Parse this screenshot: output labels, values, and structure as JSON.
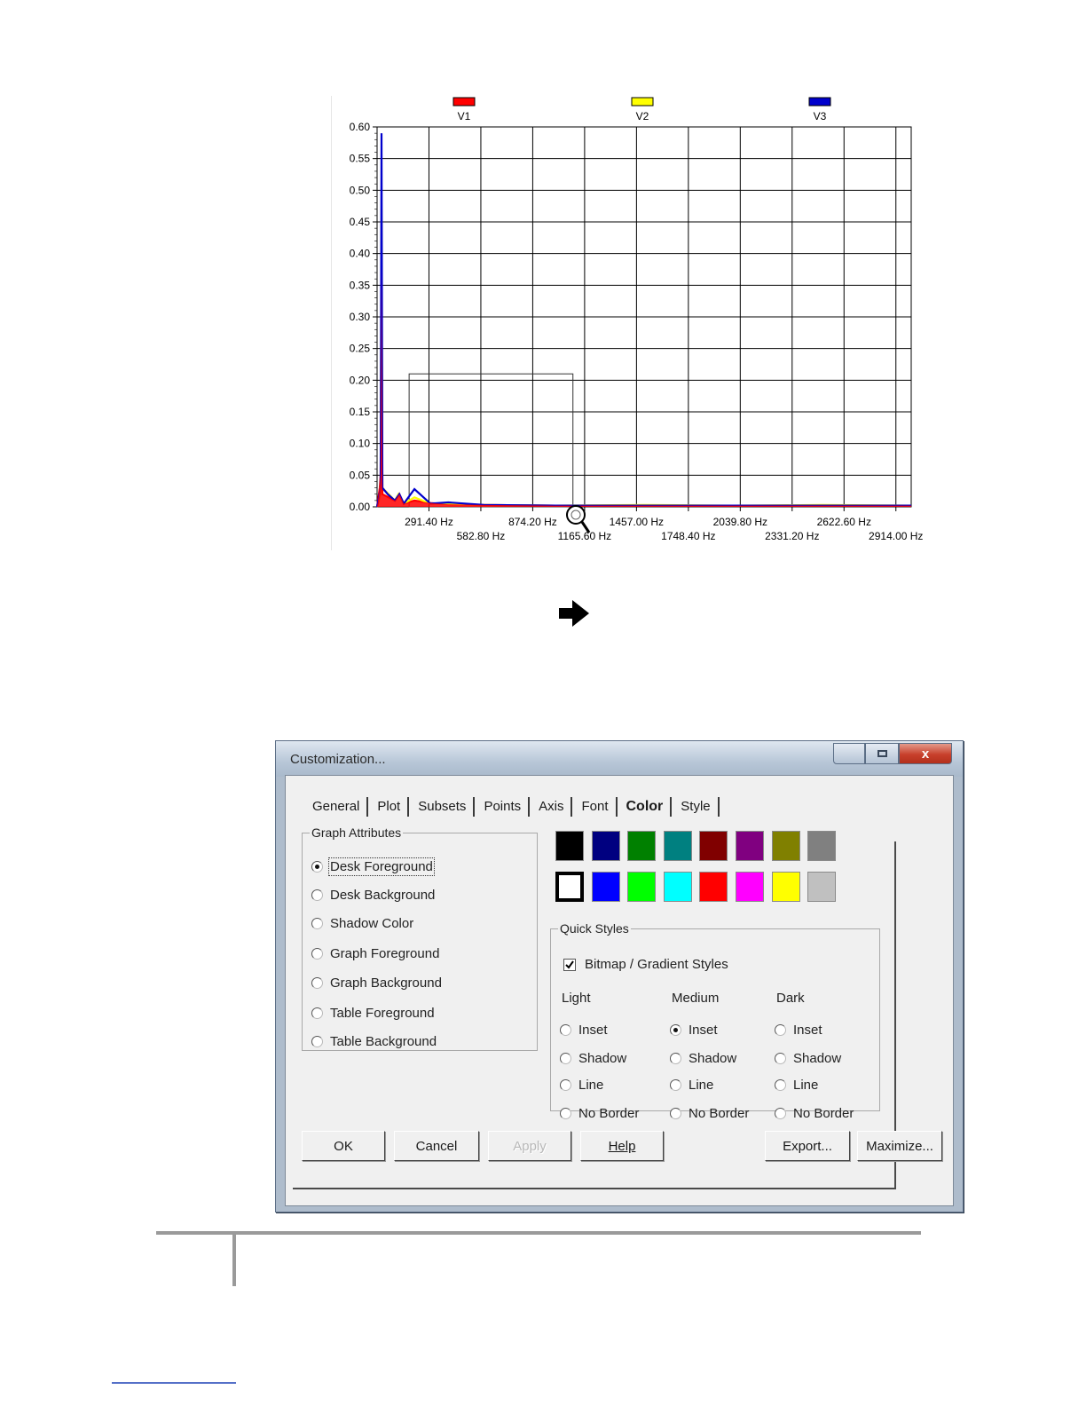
{
  "chart_data": {
    "type": "line",
    "title": "",
    "xlabel": "",
    "ylabel": "",
    "xlim": [
      0,
      3000
    ],
    "ylim": [
      0,
      0.6
    ],
    "x_unit": "Hz",
    "legend_position": "top",
    "grid": true,
    "y_ticks": [
      "0.00",
      "0.05",
      "0.10",
      "0.15",
      "0.20",
      "0.25",
      "0.30",
      "0.35",
      "0.40",
      "0.45",
      "0.50",
      "0.55",
      "0.60"
    ],
    "x_tick_values": [
      291.4,
      582.8,
      874.2,
      1165.6,
      1457.0,
      1748.4,
      2039.8,
      2331.2,
      2622.6,
      2914.0
    ],
    "x_ticks": [
      "291.40 Hz",
      "582.80 Hz",
      "874.20 Hz",
      "1165.60 Hz",
      "1457.00 Hz",
      "1748.40 Hz",
      "2039.80 Hz",
      "2331.20 Hz",
      "2622.60 Hz",
      "2914.00 Hz"
    ],
    "zoom_box": {
      "x": [
        180,
        1100
      ],
      "y": [
        0,
        0.21
      ]
    },
    "series": [
      {
        "name": "V1",
        "color": "#ff0000",
        "points": [
          [
            0,
            0
          ],
          [
            15,
            0.03
          ],
          [
            20,
            0.05
          ],
          [
            25,
            0.38
          ],
          [
            30,
            0.02
          ],
          [
            100,
            0.01
          ],
          [
            125,
            0.02
          ],
          [
            150,
            0.005
          ],
          [
            210,
            0.01
          ],
          [
            300,
            0.006
          ],
          [
            400,
            0.004
          ],
          [
            600,
            0.003
          ],
          [
            1000,
            0.002
          ],
          [
            1500,
            0.002
          ],
          [
            2000,
            0.002
          ],
          [
            2500,
            0.002
          ],
          [
            3000,
            0.002
          ]
        ]
      },
      {
        "name": "V2",
        "color": "#ffff00",
        "points": [
          [
            0,
            0
          ],
          [
            20,
            0.02
          ],
          [
            25,
            0.47
          ],
          [
            30,
            0.03
          ],
          [
            100,
            0.01
          ],
          [
            120,
            0.02
          ],
          [
            150,
            0.005
          ],
          [
            210,
            0.015
          ],
          [
            300,
            0.005
          ],
          [
            600,
            0.003
          ],
          [
            1000,
            0.002
          ],
          [
            1500,
            0.003
          ],
          [
            2000,
            0.002
          ],
          [
            2500,
            0.003
          ],
          [
            3000,
            0.002
          ]
        ]
      },
      {
        "name": "V3",
        "color": "#0000cc",
        "points": [
          [
            0,
            0
          ],
          [
            20,
            0.03
          ],
          [
            25,
            0.59
          ],
          [
            30,
            0.03
          ],
          [
            60,
            0.02
          ],
          [
            100,
            0.01
          ],
          [
            125,
            0.02
          ],
          [
            150,
            0.005
          ],
          [
            210,
            0.028
          ],
          [
            300,
            0.005
          ],
          [
            400,
            0.007
          ],
          [
            600,
            0.003
          ],
          [
            1000,
            0.002
          ],
          [
            1500,
            0.002
          ],
          [
            2000,
            0.002
          ],
          [
            2500,
            0.002
          ],
          [
            3000,
            0.002
          ]
        ]
      }
    ]
  },
  "dialog": {
    "title": "Customization...",
    "window_buttons": {
      "close": "x"
    },
    "tabs": [
      {
        "label": "General",
        "active": false
      },
      {
        "label": "Plot",
        "active": false
      },
      {
        "label": "Subsets",
        "active": false
      },
      {
        "label": "Points",
        "active": false
      },
      {
        "label": "Axis",
        "active": false
      },
      {
        "label": "Font",
        "active": false
      },
      {
        "label": "Color",
        "active": true
      },
      {
        "label": "Style",
        "active": false
      }
    ],
    "graph_attributes": {
      "legend": "Graph Attributes",
      "selected": "Desk Foreground",
      "options": [
        "Desk Foreground",
        "Desk Background",
        "Shadow Color",
        "Graph Foreground",
        "Graph Background",
        "Table Foreground",
        "Table Background"
      ]
    },
    "colors": {
      "row1": [
        "#000000",
        "#000080",
        "#008000",
        "#008080",
        "#800000",
        "#800080",
        "#808000",
        "#808080"
      ],
      "row2": [
        "#ffffff",
        "#0000ff",
        "#00ff00",
        "#00ffff",
        "#ff0000",
        "#ff00ff",
        "#ffff00",
        "#c0c0c0"
      ],
      "selected": "#ffffff"
    },
    "quick_styles": {
      "legend": "Quick Styles",
      "bitmap_label": "Bitmap / Gradient Styles",
      "bitmap_checked": true,
      "columns": [
        {
          "header": "Light",
          "options": [
            "Inset",
            "Shadow",
            "Line",
            "No Border"
          ],
          "selected": null
        },
        {
          "header": "Medium",
          "options": [
            "Inset",
            "Shadow",
            "Line",
            "No Border"
          ],
          "selected": "Inset"
        },
        {
          "header": "Dark",
          "options": [
            "Inset",
            "Shadow",
            "Line",
            "No Border"
          ],
          "selected": null
        }
      ]
    },
    "buttons": {
      "ok": "OK",
      "cancel": "Cancel",
      "apply": "Apply",
      "help": "Help",
      "export": "Export...",
      "maximize": "Maximize..."
    }
  }
}
